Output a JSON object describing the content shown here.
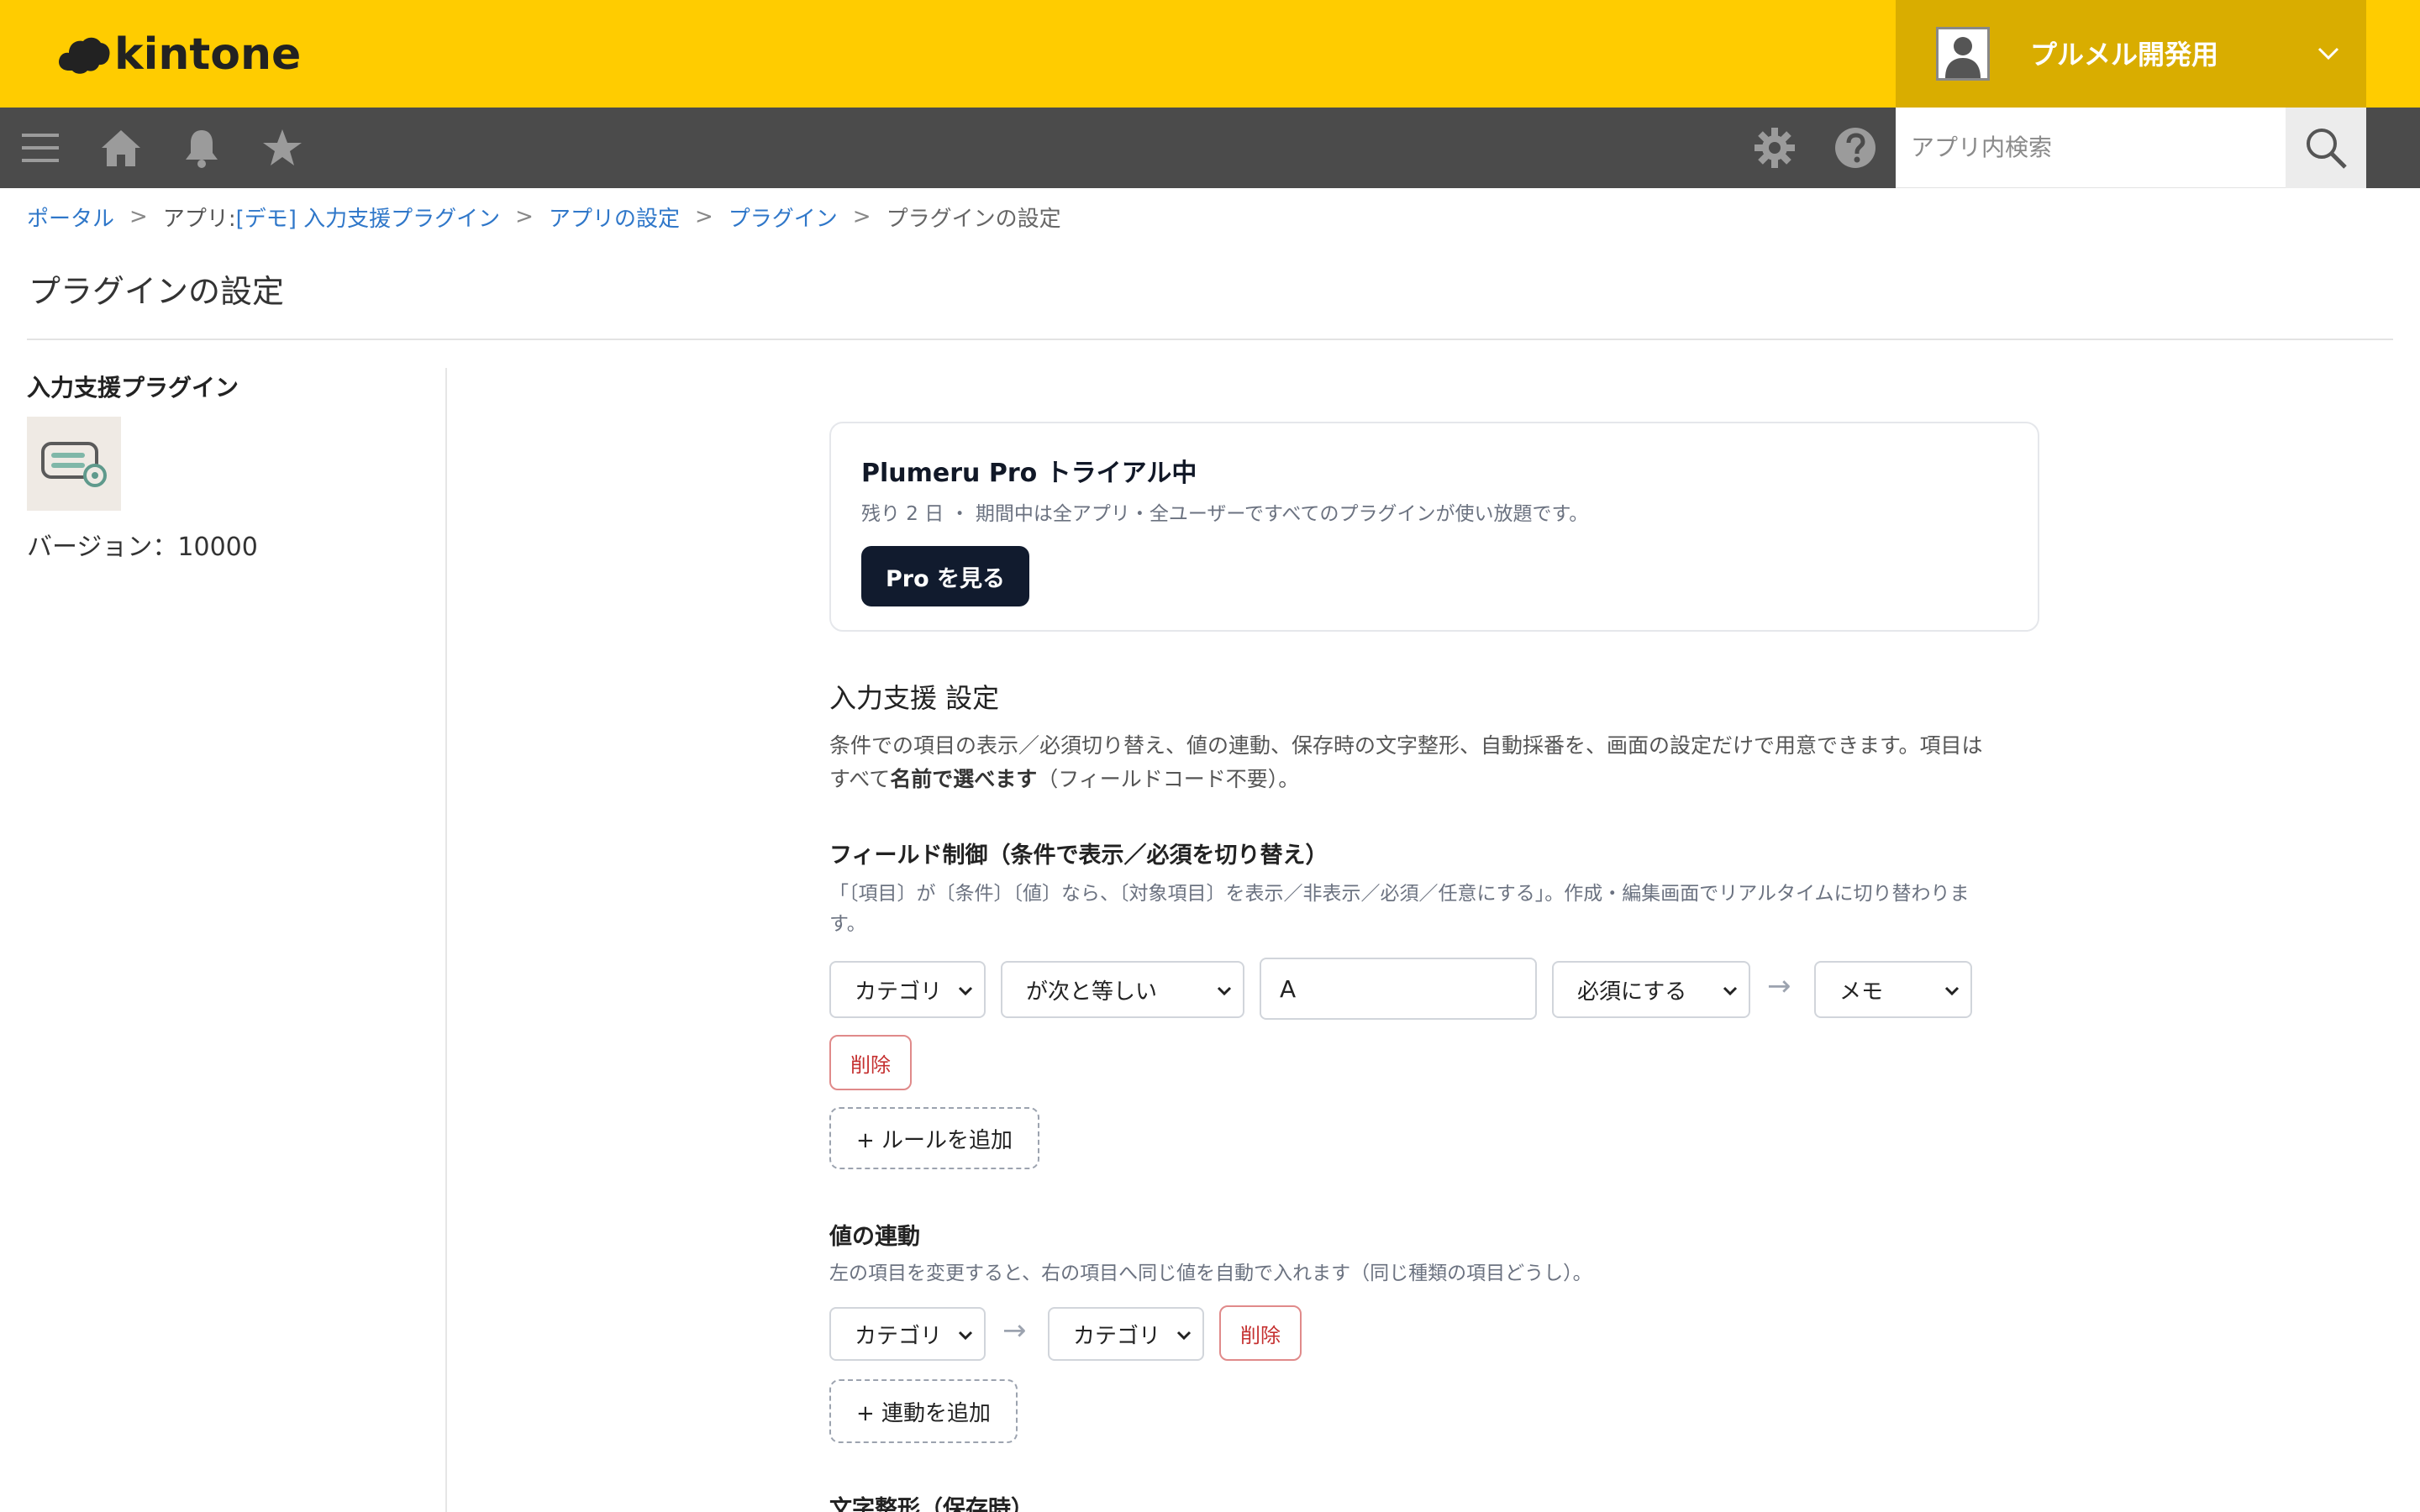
{
  "header": {
    "logo_text": "kintone",
    "user_name": "プルメル開発用"
  },
  "toolbar": {
    "icons": [
      "menu-icon",
      "home-icon",
      "bell-icon",
      "star-icon",
      "gear-icon",
      "help-icon"
    ],
    "search_placeholder": "アプリ内検索"
  },
  "breadcrumb": {
    "portal": "ポータル",
    "app_prefix": "アプリ: ",
    "app_name": "[デモ] 入力支援プラグイン",
    "app_settings": "アプリの設定",
    "plugins": "プラグイン",
    "current": "プラグインの設定",
    "separator": ">"
  },
  "page_title": "プラグインの設定",
  "sidebar": {
    "plugin_name": "入力支援プラグイン",
    "version": "バージョン：10000"
  },
  "pro_card": {
    "title": "Plumeru Pro トライアル中",
    "subtitle": "残り 2 日 ・ 期間中は全アプリ・全ユーザーですべてのプラグインが使い放題です。",
    "button": "Pro を見る"
  },
  "settings": {
    "title": "入力支援 設定",
    "desc_line1": "条件での項目の表示／必須切り替え、値の連動、保存時の文字整形、自動採番を、画面の設定だけで用意できます。項目は",
    "desc_line2_prefix": "すべて",
    "desc_line2_bold": "名前で選べます",
    "desc_line2_suffix": "（フィールドコード不要）。"
  },
  "field_control": {
    "title": "フィールド制御（条件で表示／必須を切り替え）",
    "desc_line1": "「〔項目〕が〔条件〕〔値〕なら、〔対象項目〕を表示／非表示／必須／任意にする」。作成・編集画面でリアルタイムに切り替わりま",
    "desc_line2": "す。",
    "rule": {
      "field": "カテゴリ",
      "condition": "が次と等しい",
      "value": "A",
      "action": "必須にする",
      "target": "メモ"
    },
    "delete_label": "削除",
    "add_label": "+ ルールを追加"
  },
  "value_link": {
    "title": "値の連動",
    "desc": "左の項目を変更すると、右の項目へ同じ値を自動で入れます（同じ種類の項目どうし）。",
    "rule": {
      "source": "カテゴリ",
      "target": "カテゴリ"
    },
    "delete_label": "削除",
    "add_label": "+ 連動を追加"
  },
  "text_format": {
    "title": "文字整形（保存時）"
  },
  "arrow_glyph": "→",
  "colors": {
    "header_yellow": "#ffcc00",
    "user_area": "#d9ad00",
    "toolbar": "#4b4b4b",
    "link_blue": "#2f77c9",
    "pro_button": "#111b2e",
    "delete_red": "#c53030"
  }
}
